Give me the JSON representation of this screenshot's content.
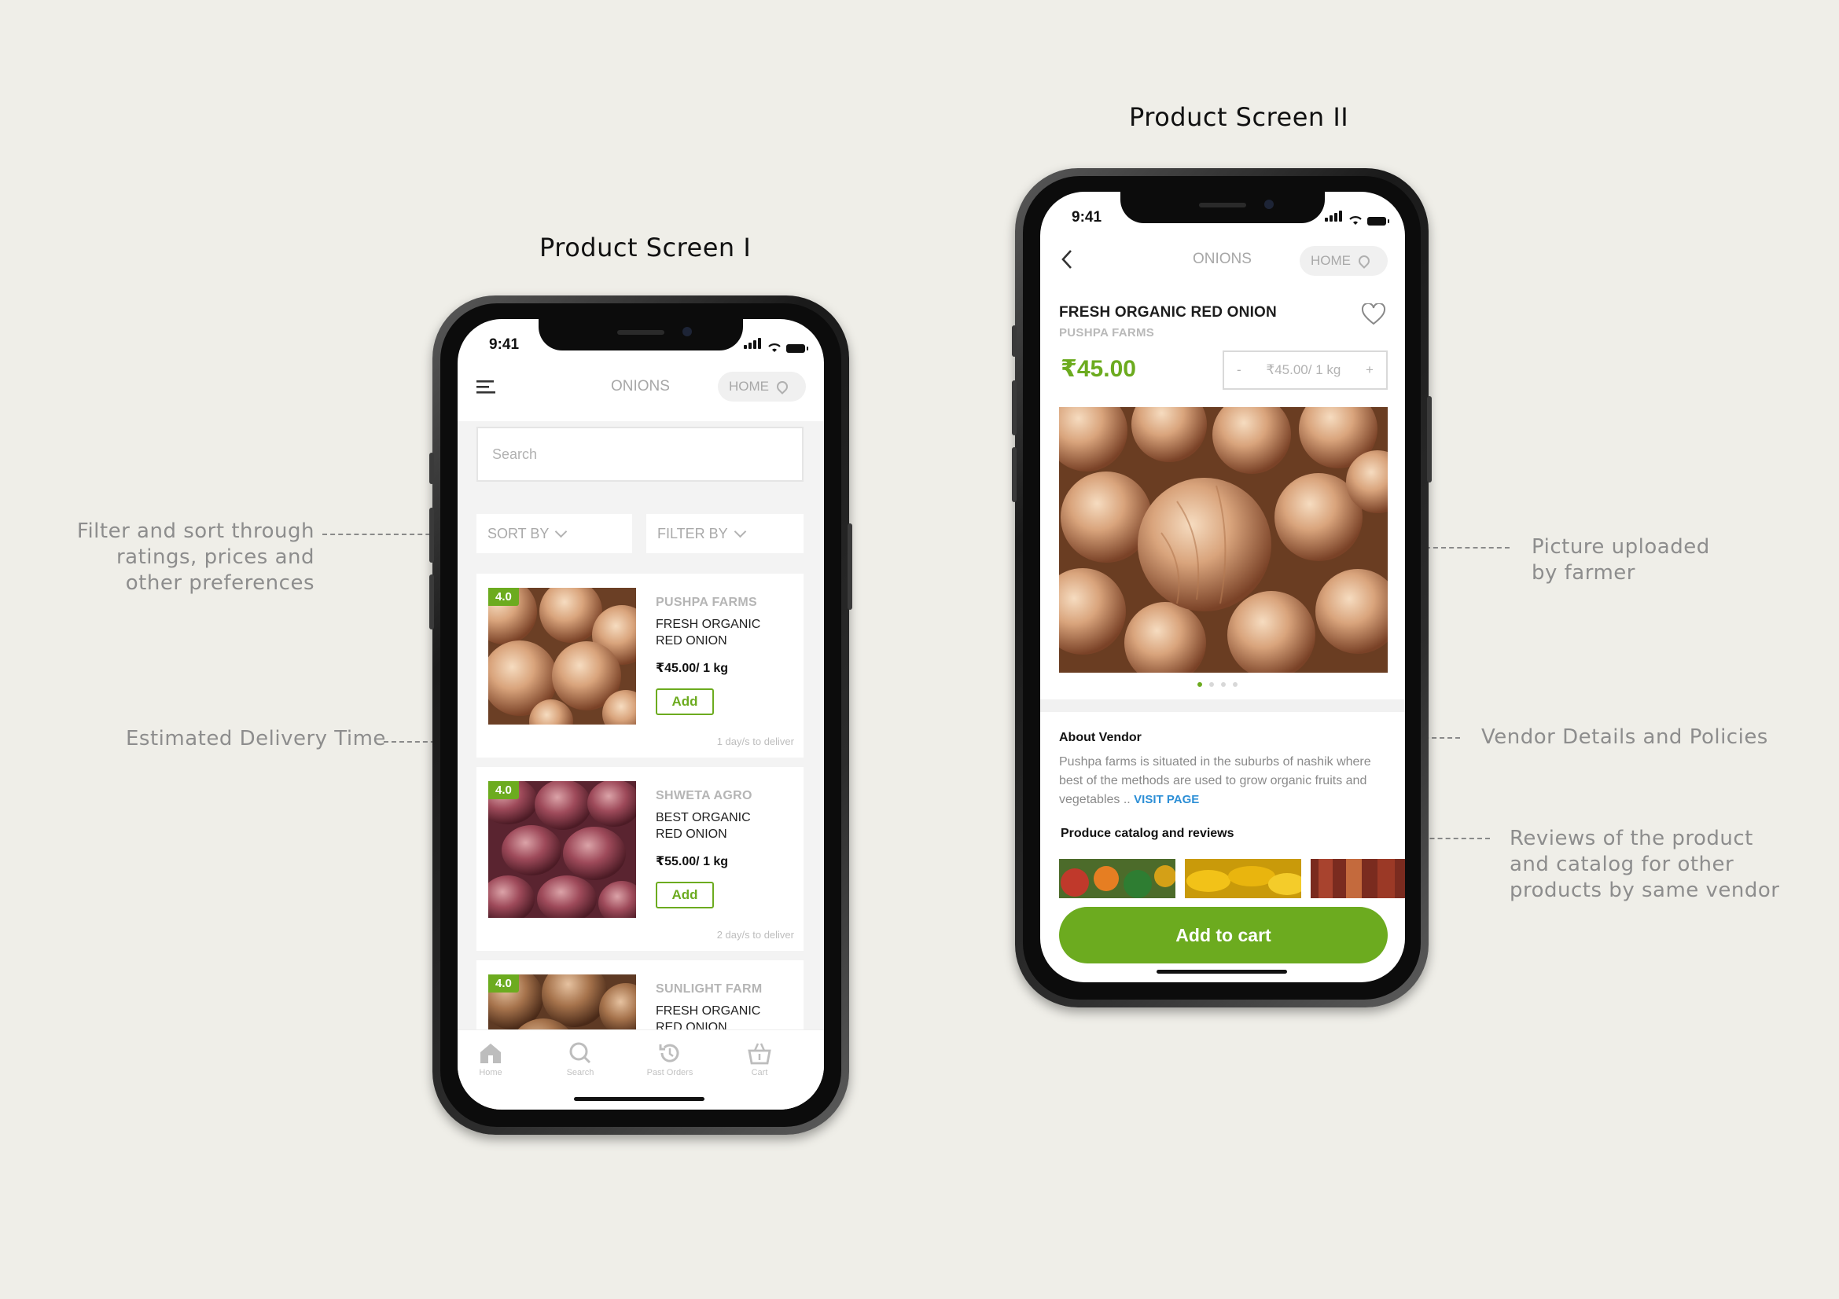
{
  "titles": {
    "screen1": "Product Screen I",
    "screen2": "Product Screen II"
  },
  "annotations": {
    "filter": [
      "Filter and sort through",
      "ratings, prices and",
      "other preferences"
    ],
    "delivery": "Estimated Delivery Time",
    "picture": [
      "Picture uploaded",
      "by farmer"
    ],
    "vendor": "Vendor Details and Policies",
    "reviews": [
      "Reviews of the product",
      "and catalog for other",
      "products by same vendor"
    ]
  },
  "status": {
    "time": "9:41"
  },
  "screen1": {
    "header": {
      "title": "ONIONS",
      "location": "HOME"
    },
    "search": {
      "placeholder": "Search"
    },
    "sort_label": "SORT BY",
    "filter_label": "FILTER BY",
    "products": [
      {
        "rating": "4.0",
        "vendor": "PUSHPA FARMS",
        "name": "FRESH ORGANIC RED ONION",
        "price": "₹45.00/ 1 kg",
        "add": "Add",
        "delivery": "1 day/s to deliver"
      },
      {
        "rating": "4.0",
        "vendor": "SHWETA AGRO",
        "name": "BEST ORGANIC RED ONION",
        "price": "₹55.00/ 1 kg",
        "add": "Add",
        "delivery": "2 day/s to deliver"
      },
      {
        "rating": "4.0",
        "vendor": "SUNLIGHT FARM",
        "name": "FRESH ORGANIC RED ONION"
      }
    ],
    "tabs": [
      {
        "label": "Home",
        "icon": "home-icon"
      },
      {
        "label": "Search",
        "icon": "search-icon"
      },
      {
        "label": "Past Orders",
        "icon": "history-icon"
      },
      {
        "label": "Cart",
        "icon": "basket-icon"
      }
    ]
  },
  "screen2": {
    "header": {
      "title": "ONIONS",
      "location": "HOME"
    },
    "product": {
      "name": "FRESH ORGANIC RED ONION",
      "vendor": "PUSHPA FARMS",
      "price": "₹45.00"
    },
    "quantity": {
      "minus": "-",
      "value": "₹45.00/ 1 kg",
      "plus": "+"
    },
    "carousel": {
      "count": 4,
      "active": 0
    },
    "about": {
      "heading": "About Vendor",
      "text": "Pushpa farms is situated in the suburbs of nashik where best of the methods are used to grow organic fruits and vegetables .. ",
      "link": "VISIT PAGE"
    },
    "catalog_heading": "Produce catalog and reviews",
    "cta": "Add to cart"
  },
  "colors": {
    "accent": "#6cab1f",
    "link": "#2d8fd6",
    "background": "#efeee8"
  }
}
